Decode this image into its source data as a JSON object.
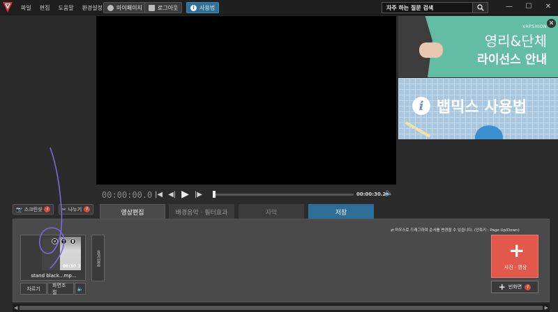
{
  "menu": [
    "파일",
    "편집",
    "도움말",
    "환경설정"
  ],
  "topbar": {
    "mypage": "마이페이지",
    "logout": "로그아웃",
    "usage": "사용법",
    "search_text": "자주 하는 질문 검색"
  },
  "ads": {
    "ad1_brand": "VAPSHION",
    "ad1_line1": "영리&단체",
    "ad1_line2": "라이선스 안내",
    "ad2_line": "뱁믹스 사용법"
  },
  "player": {
    "current_time": "00:00:00.0",
    "end_time": "00:00:30.2"
  },
  "side": {
    "screenshot": "스크린샷",
    "split": "나누기"
  },
  "tabs": [
    "영상편집",
    "배경음악 · 필터효과",
    "자막",
    "저장"
  ],
  "hint": "마우스로 드래그하여 순서를 변경할 수 있습니다.  (단축키 : Page Up/Down)",
  "clip": {
    "duration": "00:30.2",
    "name": "stand black...mp...",
    "cut": "자르기",
    "adjust": "화면조절"
  },
  "effect_label": "효과없음",
  "add_label": "사진 · 영상",
  "blank_label": "빈화면"
}
